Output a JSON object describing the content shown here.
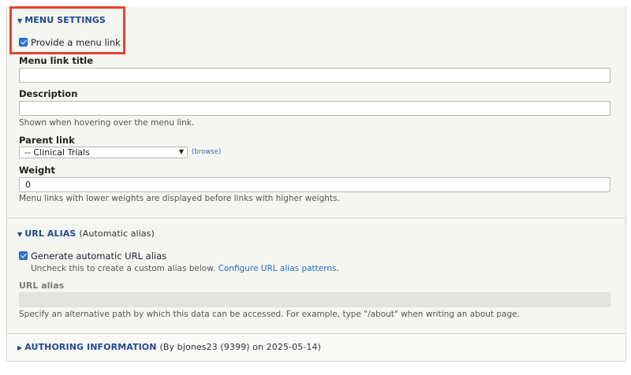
{
  "menu_settings": {
    "summary": "MENU SETTINGS",
    "provide_link_label": "Provide a menu link",
    "link_title_label": "Menu link title",
    "link_title_value": "",
    "description_label": "Description",
    "description_value": "",
    "description_help": "Shown when hovering over the menu link.",
    "parent_link_label": "Parent link",
    "parent_link_value": "-- Clinical Trials",
    "browse_link": "(browse)",
    "weight_label": "Weight",
    "weight_value": "0",
    "weight_help": "Menu links with lower weights are displayed before links with higher weights."
  },
  "url_alias": {
    "summary": "URL ALIAS",
    "summary_extra": "(Automatic alias)",
    "generate_label": "Generate automatic URL alias",
    "uncheck_help": "Uncheck this to create a custom alias below.",
    "configure_link": "Configure URL alias patterns.",
    "alias_label": "URL alias",
    "alias_value": "",
    "alias_help": "Specify an alternative path by which this data can be accessed. For example, type \"/about\" when writing an about page."
  },
  "authoring": {
    "summary": "AUTHORING INFORMATION",
    "summary_extra": "(By bjones23 (9399) on 2025-05-14)"
  },
  "colors": {
    "accent": "#1f4a8f",
    "link": "#2a6fb8",
    "highlight": "#e8422f",
    "checkbox": "#2f77d6"
  }
}
